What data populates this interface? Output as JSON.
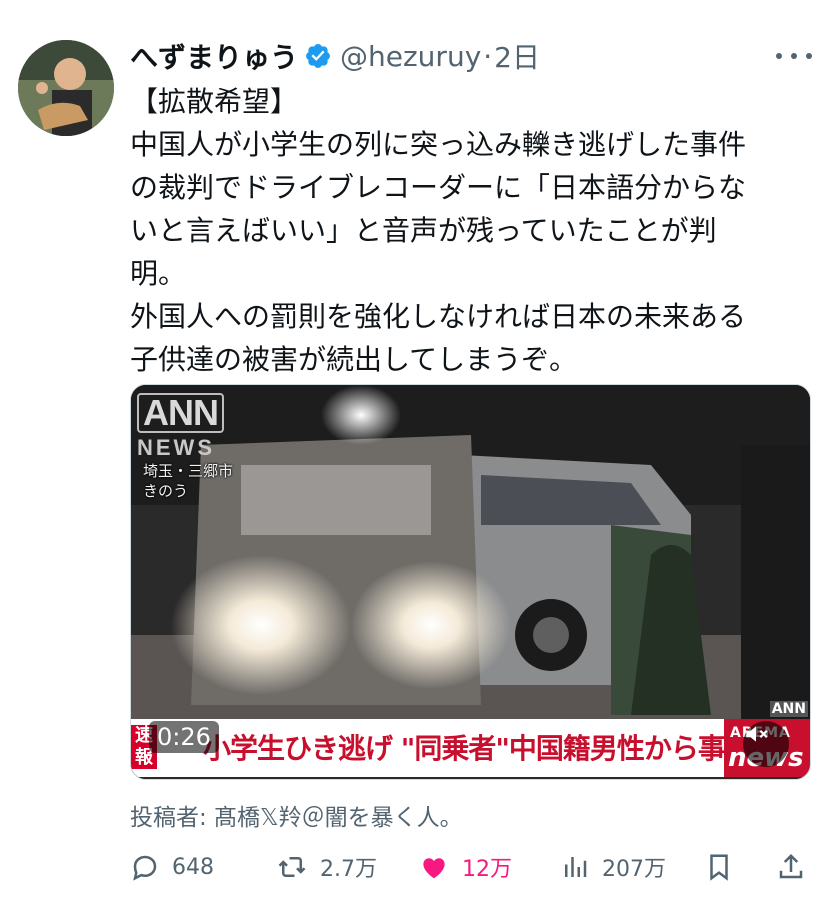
{
  "post": {
    "display_name": "へずまりゅう",
    "handle": "@hezuruy",
    "separator": "·",
    "time": "2日",
    "text_lines": [
      "【拡散希望】",
      "中国人が小学生の列に突っ込み轢き逃げした事件",
      "の裁判でドライブレコーダーに「日本語分からな",
      "いと言えばいい」と音声が残っていたことが判",
      "明。",
      "外国人への罰則を強化しなければ日本の未来ある",
      "子供達の被害が続出してしまうぞ。"
    ]
  },
  "video": {
    "ann_logo_top": "ANN",
    "ann_logo_bottom": "NEWS",
    "location_line1": "埼玉・三郷市",
    "location_line2": "きのう",
    "flash_label": "速報",
    "headline": "小学生ひき逃げ \"同乗者\"中国籍男性から事情聴く",
    "logo_top": "ABEMA",
    "logo_bottom": "news",
    "ann_small": "ANN",
    "duration": "0:26"
  },
  "credit": "投稿者: 髙橋𝕏羚＠闇を暴く人。",
  "actions": {
    "replies": "648",
    "reposts": "2.7万",
    "likes": "12万",
    "views": "207万"
  },
  "colors": {
    "verified": "#1d9bf0",
    "like": "#f91880",
    "secondary_text": "#536471",
    "banner_red": "#c8102e"
  },
  "icons": [
    "verified-badge-icon",
    "more-icon",
    "reply-icon",
    "repost-icon",
    "like-icon",
    "views-icon",
    "bookmark-icon",
    "share-icon",
    "mute-icon"
  ]
}
